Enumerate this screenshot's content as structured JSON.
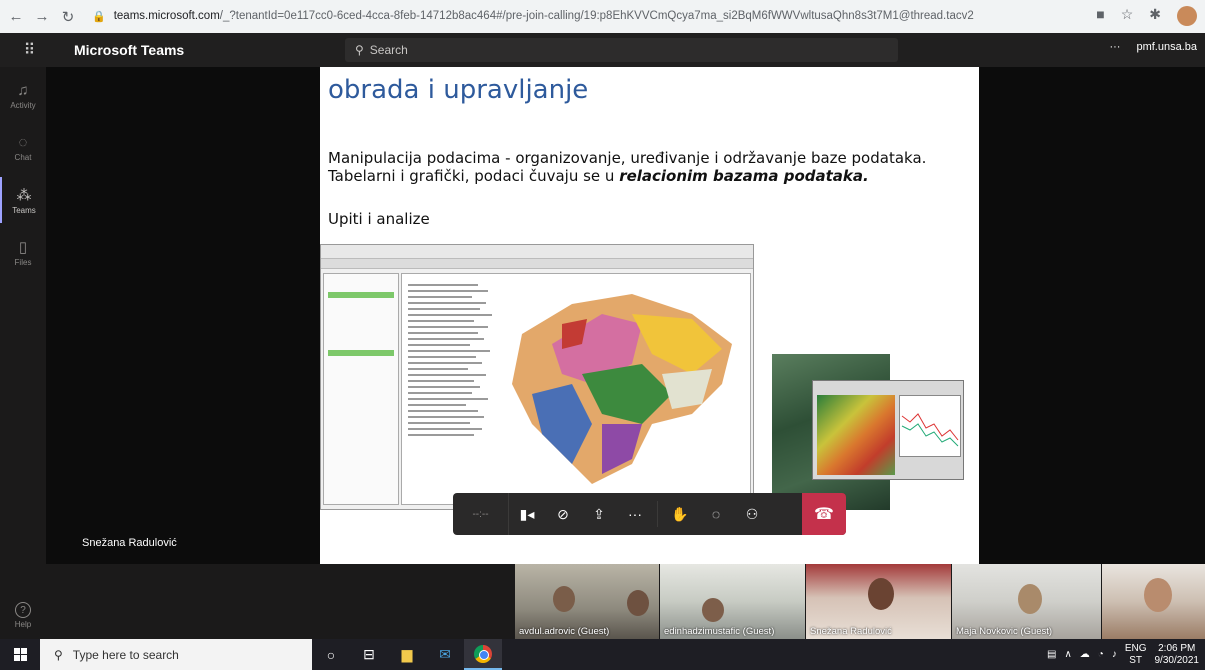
{
  "browser": {
    "url_host": "teams.microsoft.com",
    "url_rest": "/_?tenantId=0e117cc0-6ced-4cca-8feb-14712b8ac464#/pre-join-calling/19:p8EhKVVCmQcya7ma_si2BqM6fWWVwltusaQhn8s3t7M1@thread.tacv2"
  },
  "teams": {
    "app_title": "Microsoft Teams",
    "search_placeholder": "Search",
    "more_label": "···",
    "org_label": "pmf.unsa.ba"
  },
  "rail": {
    "items": [
      {
        "label": "Activity",
        "icon": "bell-icon"
      },
      {
        "label": "Chat",
        "icon": "chat-icon"
      },
      {
        "label": "Teams",
        "icon": "teams-icon"
      },
      {
        "label": "Files",
        "icon": "file-icon"
      }
    ],
    "help_label": "Help"
  },
  "stage": {
    "presenter_name": "Snežana Radulović"
  },
  "slide": {
    "title": "obrada i upravljanje",
    "line1": "Manipulacija podacima - organizovanje, uređivanje i održavanje baze podataka.",
    "line2_prefix": "Tabelarni i grafički, podaci  čuvaju se u ",
    "line2_emph": "relacionim bazama podataka",
    "line2_suffix": ".",
    "line3": "Upiti i analize"
  },
  "controls": {
    "timer": "--:--"
  },
  "participants": [
    {
      "name": "avdul.adrovic (Guest)"
    },
    {
      "name": "edinhadzimustafic (Guest)"
    },
    {
      "name": "Snežana Radulović"
    },
    {
      "name": "Maja Novkovic (Guest)"
    },
    {
      "name": ""
    }
  ],
  "taskbar": {
    "search_placeholder": "Type here to search",
    "lang_top": "ENG",
    "lang_bottom": "ST",
    "time": "2:06 PM",
    "date": "9/30/2021"
  },
  "colors": {
    "hangup": "#c4314b",
    "slide_title": "#2e5a9c",
    "teams_header": "#201f1f"
  }
}
